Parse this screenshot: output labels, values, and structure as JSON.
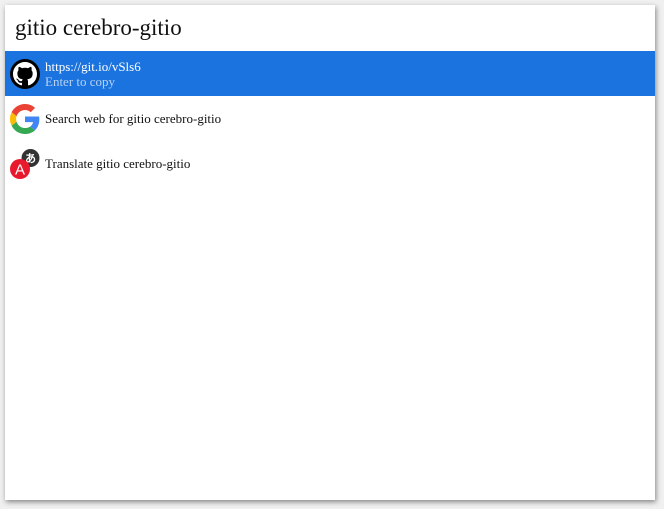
{
  "search": {
    "value": "gitio cerebro-gitio"
  },
  "results": [
    {
      "icon": "github-icon",
      "title": "https://git.io/vSls6",
      "subtitle": "Enter to copy",
      "selected": true
    },
    {
      "icon": "google-icon",
      "title": "Search web for gitio cerebro-gitio",
      "subtitle": "",
      "selected": false
    },
    {
      "icon": "translate-icon",
      "title": "Translate gitio cerebro-gitio",
      "subtitle": "",
      "selected": false
    }
  ],
  "colors": {
    "selection": "#1a73de",
    "google_blue": "#4285f4",
    "google_red": "#ea4335",
    "google_yellow": "#fbbc05",
    "google_green": "#34a853",
    "translate_red": "#e8192c"
  },
  "icon_glyphs": {
    "translate_source": "A",
    "translate_target": "あ"
  }
}
